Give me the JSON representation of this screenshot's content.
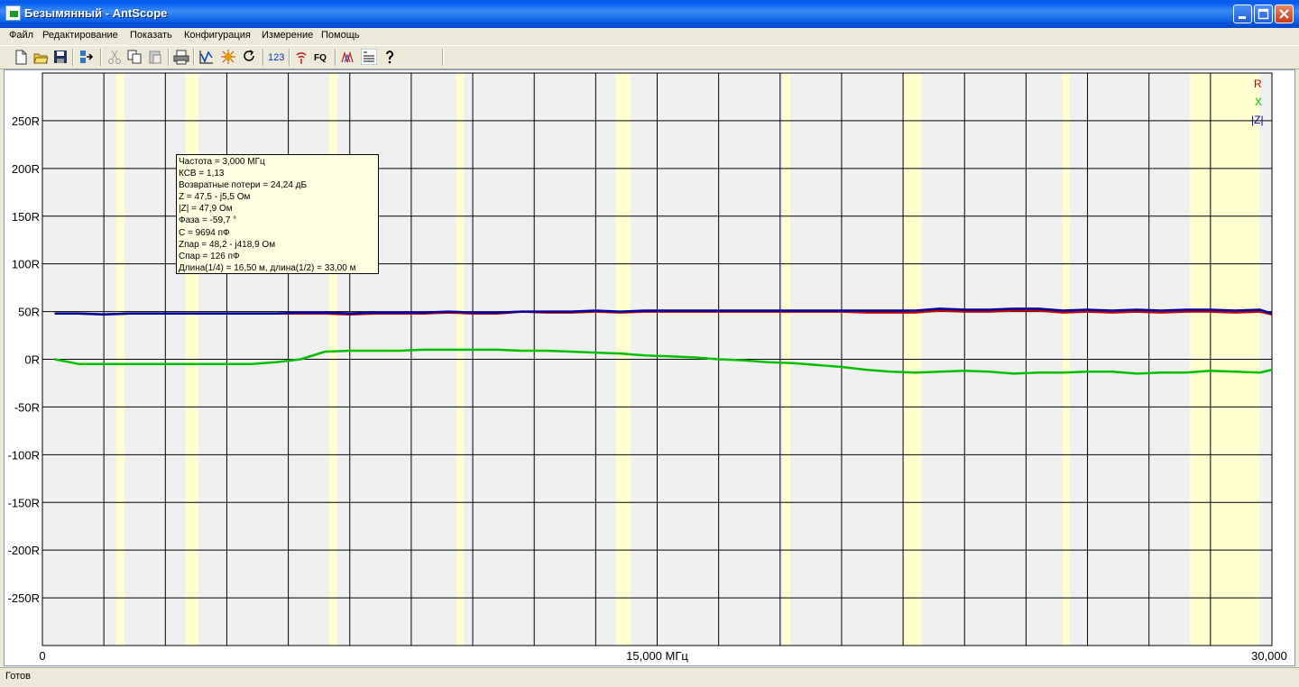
{
  "window": {
    "title": "Безымянный - AntScope",
    "controls": [
      "minimize",
      "maximize",
      "close"
    ]
  },
  "menu": [
    "Файл",
    "Редактирование",
    "Показать",
    "Конфигурация",
    "Измерение",
    "Помощь"
  ],
  "toolbar": {
    "icons": [
      "new-file-icon",
      "open-folder-icon",
      "save-icon",
      "export-icon",
      "cut-icon",
      "copy-icon",
      "paste-icon",
      "print-icon",
      "scan-graph-icon",
      "sweep-icon",
      "refresh-icon",
      "numeric-icon",
      "signal-generator-icon",
      "frequency-icon",
      "auto-scale-icon",
      "memo-icon",
      "help-icon"
    ],
    "labels": {
      "numeric": "123",
      "frequency": "FQ"
    }
  },
  "tooltip": {
    "lines": [
      "Частота = 3,000 МГц",
      "КСВ = 1,13",
      "Возвратные потери = 24,24 дБ",
      "Z = 47,5 - j5,5 Ом",
      "|Z| = 47,9 Ом",
      "Фаза = -59,7 °",
      "C = 9694 пФ",
      "Zпар = 48,2 - j418,9 Ом",
      "Спар = 126 пФ",
      "Длина(1/4) = 16,50 м, длина(1/2) = 33,00 м"
    ]
  },
  "chart_data": {
    "type": "line",
    "x_tick_labels": [
      "0",
      "15,000 МГц",
      "30,000"
    ],
    "xlim": [
      0,
      30
    ],
    "y_tick_labels": [
      "250R",
      "200R",
      "150R",
      "100R",
      "50R",
      "0R",
      "-50R",
      "-100R",
      "-150R",
      "-200R",
      "-250R"
    ],
    "y_ticks": [
      250,
      200,
      150,
      100,
      50,
      0,
      -50,
      -100,
      -150,
      -200,
      -250
    ],
    "ylim": [
      -300,
      300
    ],
    "grid": true,
    "x_gridlines_mhz": [
      0,
      1.5,
      3,
      4.5,
      6,
      7.5,
      9,
      10.5,
      12,
      13.5,
      15,
      16.5,
      18,
      19.5,
      21,
      22.5,
      24,
      25.5,
      27,
      28.5,
      30
    ],
    "highlight_bands_mhz": [
      [
        1.8,
        2.0
      ],
      [
        3.5,
        3.8
      ],
      [
        7.0,
        7.2
      ],
      [
        10.1,
        10.15
      ],
      [
        14.0,
        14.35
      ],
      [
        18.068,
        18.168
      ],
      [
        21.0,
        21.45
      ],
      [
        24.89,
        24.99
      ],
      [
        28.0,
        29.7
      ]
    ],
    "legend": [
      "R",
      "X",
      "|Z|"
    ],
    "legend_position": "top-right",
    "colors": {
      "R": "#c00000",
      "X": "#00c000",
      "|Z|": "#0000a0",
      "band": "#ffffd0",
      "plot_bg": "#f0f0f0"
    },
    "x": [
      0.3,
      0.9,
      1.5,
      2.1,
      2.7,
      3.3,
      3.9,
      4.5,
      5.1,
      5.7,
      6.3,
      6.9,
      7.5,
      8.1,
      8.7,
      9.3,
      9.9,
      10.5,
      11.1,
      11.7,
      12.3,
      12.9,
      13.5,
      14.1,
      14.7,
      15.3,
      15.9,
      16.5,
      17.1,
      17.7,
      18.3,
      18.9,
      19.5,
      20.1,
      20.7,
      21.3,
      21.9,
      22.5,
      23.1,
      23.7,
      24.3,
      24.9,
      25.5,
      26.1,
      26.7,
      27.3,
      27.9,
      28.5,
      29.1,
      29.7,
      30.0
    ],
    "series": [
      {
        "name": "R",
        "values": [
          48,
          48,
          47,
          48,
          48,
          48,
          48,
          48,
          48,
          48,
          48,
          48,
          47,
          48,
          48,
          48,
          49,
          48,
          48,
          50,
          49,
          49,
          50,
          49,
          50,
          50,
          50,
          50,
          50,
          50,
          50,
          50,
          50,
          49,
          49,
          49,
          51,
          50,
          50,
          51,
          51,
          49,
          50,
          49,
          50,
          49,
          50,
          50,
          49,
          50,
          47
        ]
      },
      {
        "name": "X",
        "values": [
          0,
          -5,
          -5,
          -5,
          -5,
          -5,
          -5,
          -5,
          -5,
          -3,
          0,
          8,
          9,
          9,
          9,
          10,
          10,
          10,
          10,
          9,
          9,
          8,
          7,
          6,
          4,
          3,
          2,
          0,
          -1,
          -3,
          -4,
          -6,
          -8,
          -11,
          -13,
          -14,
          -13,
          -12,
          -13,
          -15,
          -14,
          -14,
          -13,
          -13,
          -15,
          -14,
          -14,
          -12,
          -13,
          -14,
          -11
        ]
      },
      {
        "name": "|Z|",
        "values": [
          48,
          48,
          47,
          48,
          48,
          48,
          48,
          48,
          48,
          48,
          49,
          49,
          48,
          49,
          49,
          49,
          50,
          49,
          49,
          50,
          50,
          50,
          51,
          50,
          51,
          51,
          51,
          51,
          51,
          51,
          51,
          51,
          51,
          51,
          51,
          51,
          53,
          52,
          52,
          53,
          53,
          51,
          52,
          51,
          52,
          51,
          52,
          52,
          51,
          52,
          48
        ]
      }
    ]
  },
  "status": {
    "text": "Готов"
  }
}
